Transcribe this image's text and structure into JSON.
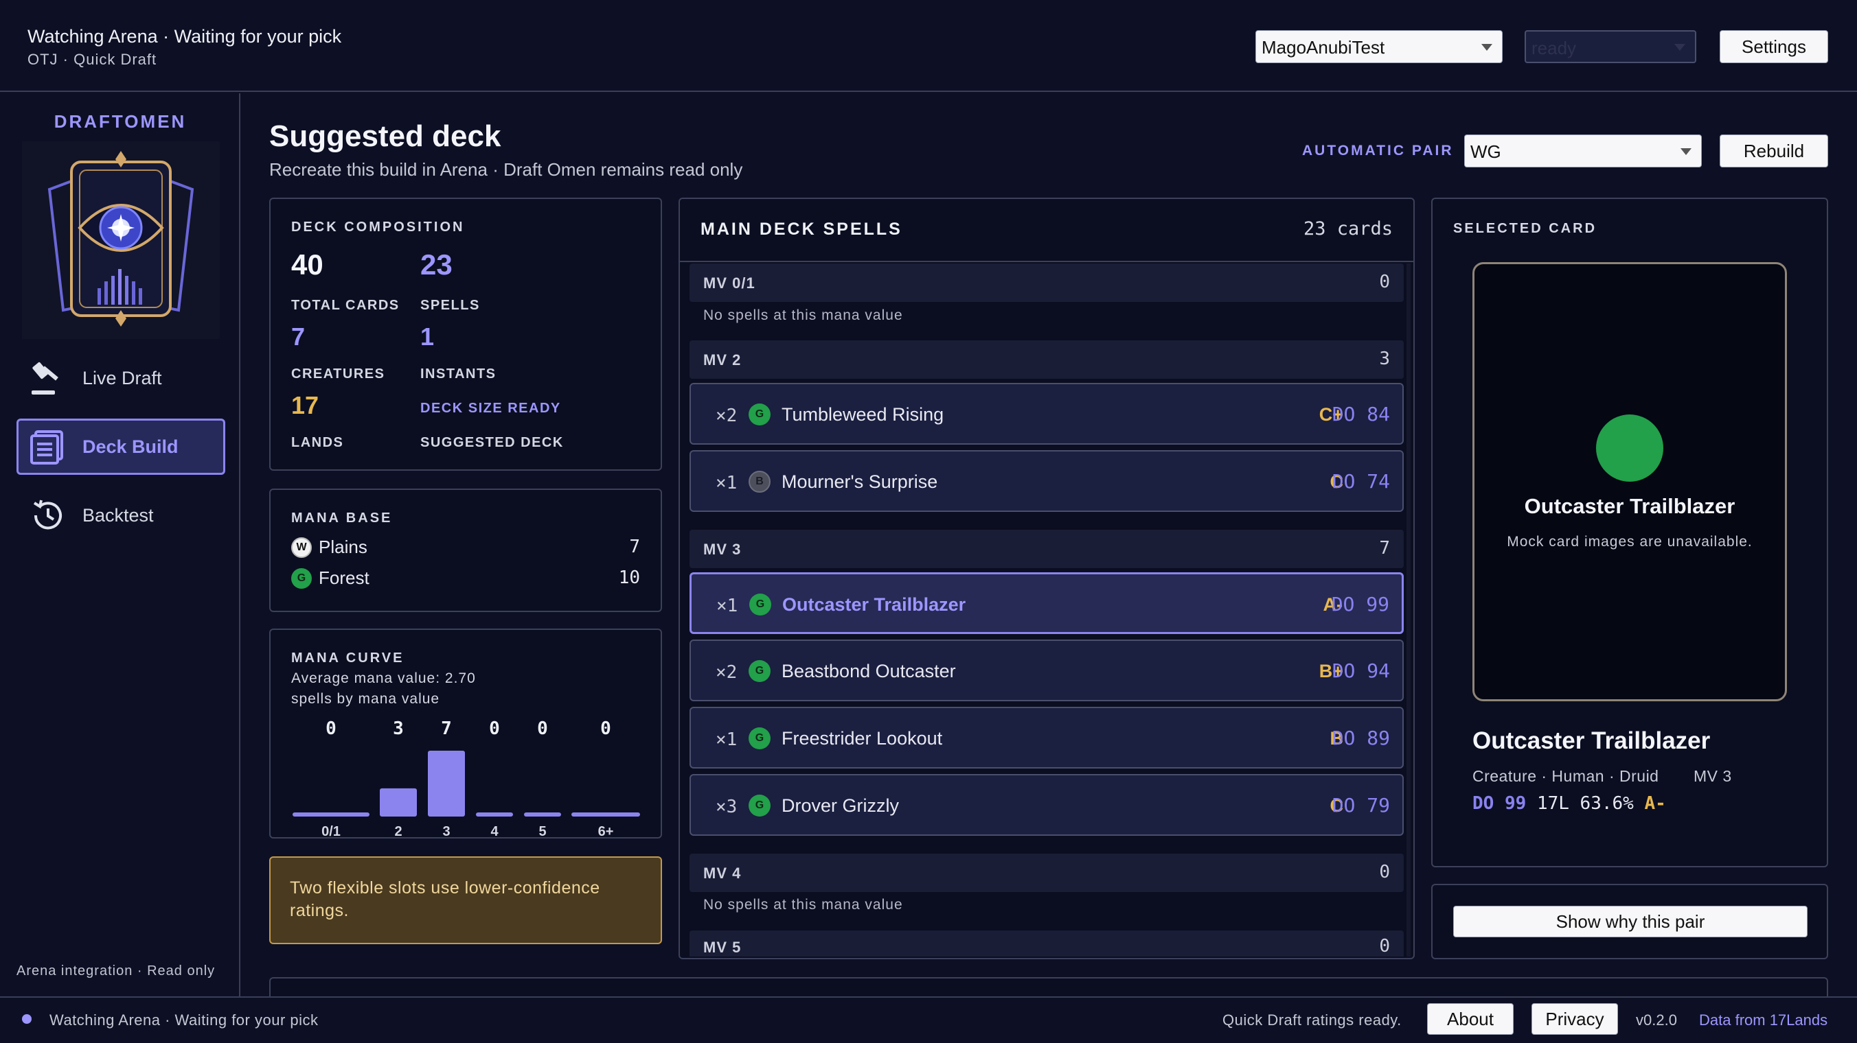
{
  "header": {
    "status_title": "Watching Arena · Waiting for your pick",
    "subtitle": "OTJ · Quick Draft",
    "account_select": "MagoAnubiTest",
    "state_select": "ready",
    "settings_label": "Settings"
  },
  "sidebar": {
    "brand": "DRAFTOMEN",
    "items": [
      {
        "label": "Live Draft",
        "icon": "gavel-icon"
      },
      {
        "label": "Deck Build",
        "icon": "deck-icon"
      },
      {
        "label": "Backtest",
        "icon": "history-icon"
      }
    ],
    "active": "Deck Build",
    "footer": "Arena integration · Read only"
  },
  "page": {
    "title": "Suggested deck",
    "subtitle": "Recreate this build in Arena · Draft Omen remains read only",
    "pair_label": "AUTOMATIC PAIR",
    "pair_value": "WG",
    "rebuild_label": "Rebuild"
  },
  "composition": {
    "title": "DECK COMPOSITION",
    "total_cards": "40",
    "total_cards_label": "TOTAL CARDS",
    "spells": "23",
    "spells_label": "SPELLS",
    "creatures": "7",
    "creatures_label": "CREATURES",
    "instants": "1",
    "instants_label": "INSTANTS",
    "lands": "17",
    "lands_label": "LANDS",
    "status": "DECK SIZE READY",
    "status_label": "SUGGESTED DECK"
  },
  "mana_base": {
    "title": "MANA BASE",
    "lands": [
      {
        "symbol": "W",
        "name": "Plains",
        "count": "7"
      },
      {
        "symbol": "G",
        "name": "Forest",
        "count": "10"
      }
    ]
  },
  "mana_curve": {
    "title": "MANA CURVE",
    "average": "Average mana value: 2.70",
    "caption": "spells by mana value"
  },
  "chart_data": {
    "type": "bar",
    "categories": [
      "0/1",
      "2",
      "3",
      "4",
      "5",
      "6+"
    ],
    "values": [
      0,
      3,
      7,
      0,
      0,
      0
    ],
    "title": "MANA CURVE",
    "ylim": [
      0,
      7
    ]
  },
  "warning": "Two flexible slots use lower-confidence ratings.",
  "main_deck": {
    "title": "MAIN DECK SPELLS",
    "count": "23 cards",
    "no_spells": "No spells at this mana value",
    "groups": [
      {
        "label": "MV 0/1",
        "count": "0"
      },
      {
        "label": "MV 2",
        "count": "3"
      },
      {
        "label": "MV 3",
        "count": "7"
      },
      {
        "label": "MV 4",
        "count": "0"
      },
      {
        "label": "MV 5",
        "count": "0"
      }
    ],
    "cards": [
      {
        "qty": "×2",
        "color": "G",
        "name": "Tumbleweed Rising",
        "grade": "C+",
        "do": "DO 84"
      },
      {
        "qty": "×1",
        "color": "B",
        "name": "Mourner's Surprise",
        "grade": "C",
        "do": "DO 74"
      },
      {
        "qty": "×1",
        "color": "G",
        "name": "Outcaster Trailblazer",
        "grade": "A-",
        "do": "DO 99"
      },
      {
        "qty": "×2",
        "color": "G",
        "name": "Beastbond Outcaster",
        "grade": "B+",
        "do": "DO 94"
      },
      {
        "qty": "×1",
        "color": "G",
        "name": "Freestrider Lookout",
        "grade": "B",
        "do": "DO 89"
      },
      {
        "qty": "×3",
        "color": "G",
        "name": "Drover Grizzly",
        "grade": "C",
        "do": "DO 79"
      }
    ]
  },
  "selected_card": {
    "title": "SELECTED CARD",
    "card_name": "Outcaster Trailblazer",
    "mock_note": "Mock card images are unavailable.",
    "type_line": "Creature · Human · Druid",
    "mv": "MV 3",
    "do": "DO 99",
    "stats": "17L 63.6%",
    "grade": "A-",
    "color": "#22a04a",
    "why_label": "Show why this pair"
  },
  "footer": {
    "status": "Watching Arena · Waiting for your pick",
    "ratings": "Quick Draft ratings ready.",
    "about": "About",
    "privacy": "Privacy",
    "version": "v0.2.0",
    "data_link": "Data from 17Lands"
  },
  "colors": {
    "accent": "#8c84ee",
    "background": "#0d1024",
    "grade": "#e8b84f",
    "green_mana": "#22a04a"
  }
}
